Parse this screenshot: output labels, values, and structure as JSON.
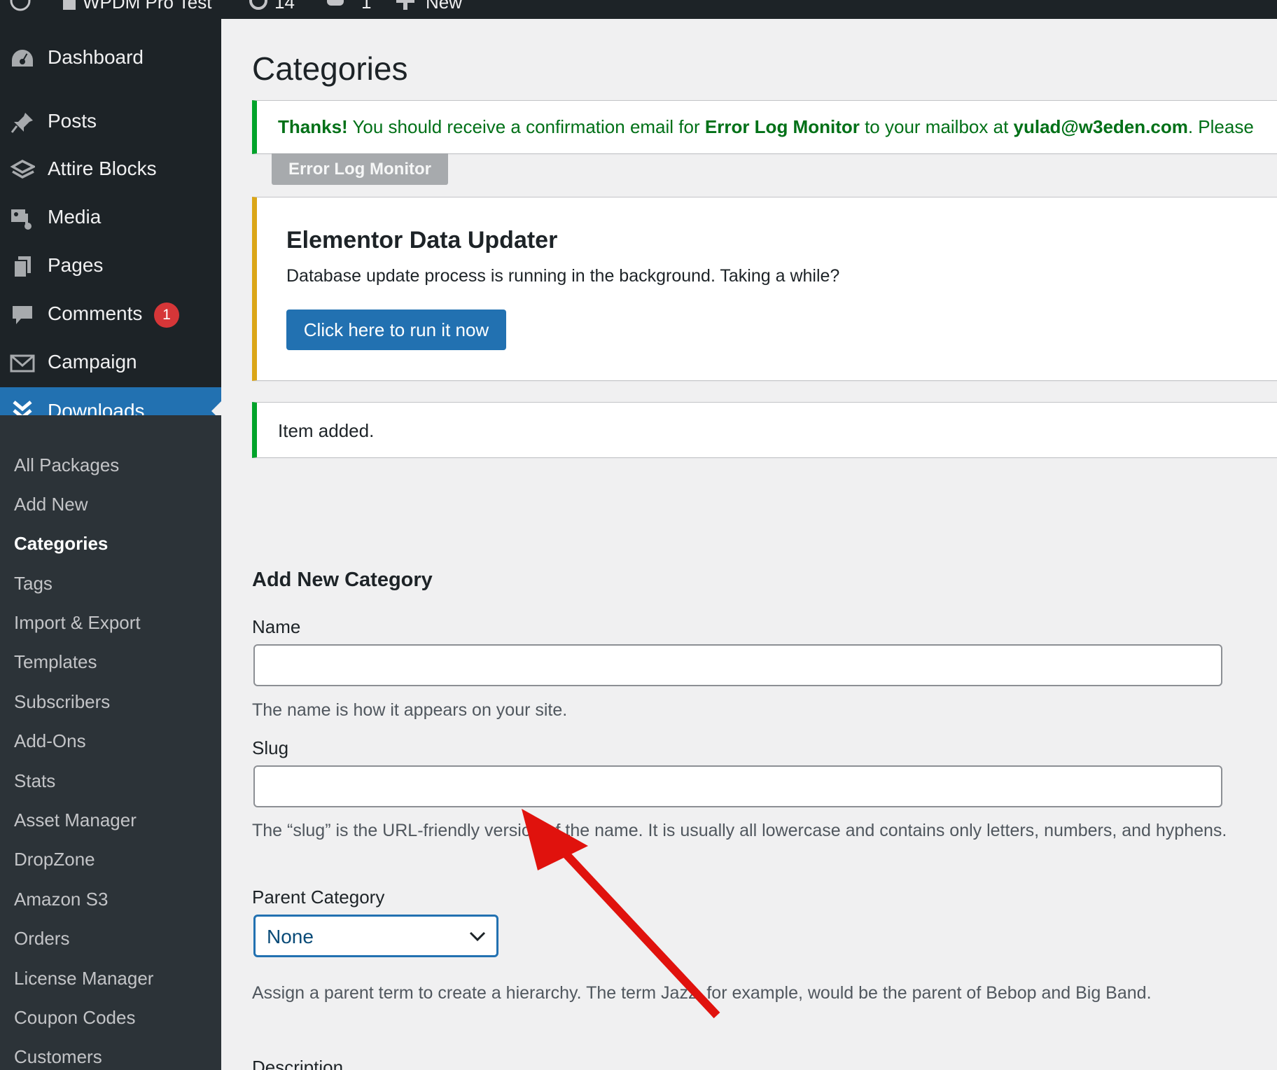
{
  "admin_bar": {
    "site_name": "WPDM Pro Test",
    "updates_count": "14",
    "comments_count": "1",
    "new_label": "New"
  },
  "sidebar": {
    "items": [
      {
        "label": "Dashboard",
        "icon": "dashboard-icon"
      },
      {
        "label": "Posts",
        "icon": "pin-icon"
      },
      {
        "label": "Attire Blocks",
        "icon": "blocks-icon"
      },
      {
        "label": "Media",
        "icon": "media-icon"
      },
      {
        "label": "Pages",
        "icon": "pages-icon"
      },
      {
        "label": "Comments",
        "icon": "comment-icon",
        "badge": "1"
      },
      {
        "label": "Campaign",
        "icon": "envelope-icon"
      },
      {
        "label": "Downloads",
        "icon": "download-icon",
        "current": true
      }
    ],
    "submenu": [
      "All Packages",
      "Add New",
      "Categories",
      "Tags",
      "Import & Export",
      "Templates",
      "Subscribers",
      "Add-Ons",
      "Stats",
      "Asset Manager",
      "DropZone",
      "Amazon S3",
      "Orders",
      "License Manager",
      "Coupon Codes",
      "Customers"
    ],
    "submenu_current": "Categories"
  },
  "main": {
    "page_title": "Categories",
    "notice_email": {
      "thanks": "Thanks!",
      "text1": " You should receive a confirmation email for ",
      "product": "Error Log Monitor",
      "text2": " to your mailbox at ",
      "email": "yulad@w3eden.com",
      "text3": ". Please",
      "tag_label": "Error Log Monitor"
    },
    "notice_updater": {
      "title": "Elementor Data Updater",
      "description": "Database update process is running in the background. Taking a while?",
      "button": "Click here to run it now"
    },
    "notice_added": {
      "text": "Item added."
    },
    "form": {
      "heading": "Add New Category",
      "name_label": "Name",
      "name_value": "",
      "name_help": "The name is how it appears on your site.",
      "slug_label": "Slug",
      "slug_value": "",
      "slug_help": "The “slug” is the URL-friendly version of the name. It is usually all lowercase and contains only letters, numbers, and hyphens.",
      "parent_label": "Parent Category",
      "parent_value": "None",
      "parent_help": "Assign a parent term to create a hierarchy. The term Jazz, for example, would be the parent of Bebop and Big Band.",
      "description_label": "Description"
    }
  },
  "colors": {
    "admin_dark": "#1d2327",
    "submenu_bg": "#2c3338",
    "accent_blue": "#2271b1",
    "success_green": "#00a32a",
    "warning_orange": "#dba617",
    "badge_red": "#d63638",
    "annotation_arrow": "#e0120d"
  }
}
